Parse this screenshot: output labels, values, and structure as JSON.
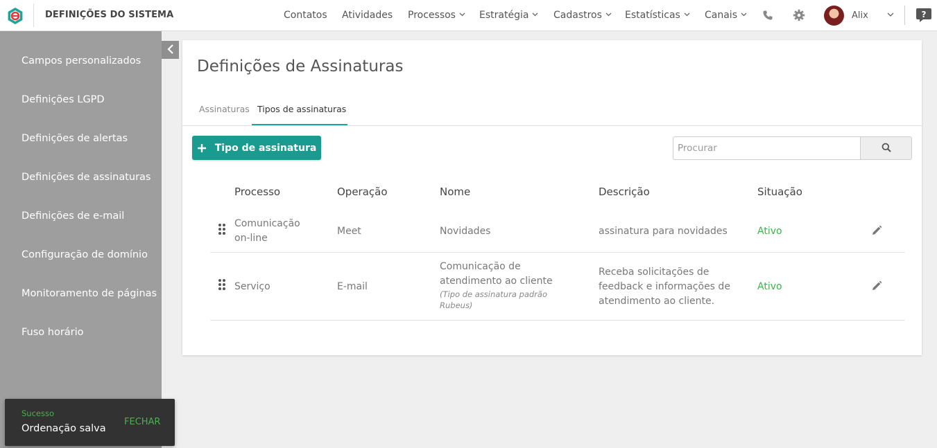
{
  "header": {
    "app_title": "DEFINIÇÕES DO SISTEMA",
    "nav": [
      {
        "label": "Contatos",
        "dropdown": false
      },
      {
        "label": "Atividades",
        "dropdown": false
      },
      {
        "label": "Processos",
        "dropdown": true
      },
      {
        "label": "Estratégia",
        "dropdown": true
      },
      {
        "label": "Cadastros",
        "dropdown": true
      },
      {
        "label": "Estatísticas",
        "dropdown": true
      },
      {
        "label": "Canais",
        "dropdown": true
      }
    ],
    "icons": [
      "phone-icon",
      "gear-icon",
      "help-icon"
    ],
    "user_name": "Alix"
  },
  "sidebar": {
    "items": [
      {
        "label": "Campos personalizados"
      },
      {
        "label": "Definições LGPD"
      },
      {
        "label": "Definições de alertas"
      },
      {
        "label": "Definições de assinaturas"
      },
      {
        "label": "Definições de e-mail"
      },
      {
        "label": "Configuração de domínio"
      },
      {
        "label": "Monitoramento de páginas"
      },
      {
        "label": "Fuso horário"
      }
    ]
  },
  "main": {
    "title": "Definições de Assinaturas",
    "tabs": [
      {
        "label": "Assinaturas",
        "active": false
      },
      {
        "label": "Tipos de assinaturas",
        "active": true
      }
    ],
    "add_button_label": "Tipo de assinatura",
    "search": {
      "placeholder": "Procurar",
      "value": ""
    },
    "table": {
      "columns": [
        "Processo",
        "Operação",
        "Nome",
        "Descrição",
        "Situação"
      ],
      "rows": [
        {
          "processo": "Comunicação on-line",
          "operacao": "Meet",
          "nome": "Novidades",
          "nome_hint": "",
          "descricao": "assinatura para novidades",
          "situacao": "Ativo"
        },
        {
          "processo": "Serviço",
          "operacao": "E-mail",
          "nome": "Comunicação de atendimento ao cliente",
          "nome_hint": "(Tipo de assinatura padrão Rubeus)",
          "descricao": "Receba solicitações de feedback e informações de atendimento ao cliente.",
          "situacao": "Ativo"
        }
      ]
    }
  },
  "toast": {
    "type": "Sucesso",
    "message": "Ordenação salva",
    "action": "FECHAR"
  },
  "colors": {
    "accent": "#1a9b90",
    "sidebar": "#9e9e9e",
    "status_active": "#3bb54a",
    "toast_bg": "#323232"
  }
}
